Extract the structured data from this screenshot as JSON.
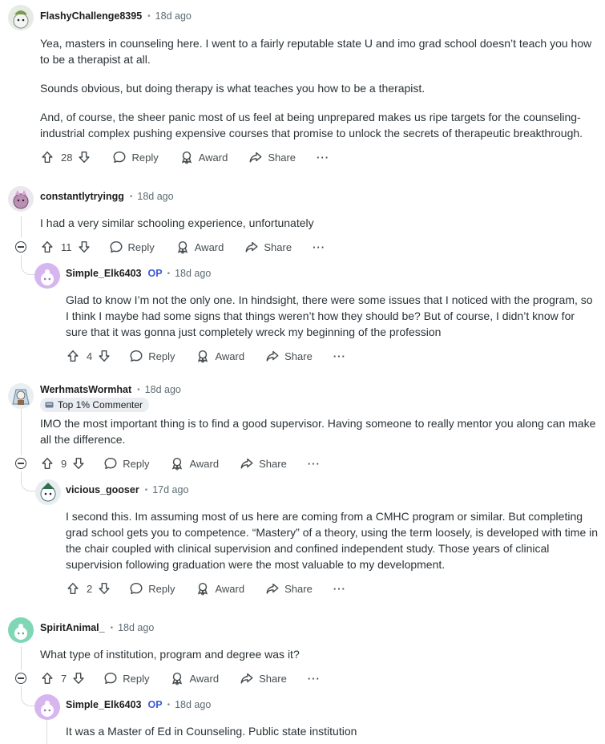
{
  "comments": [
    {
      "author": "FlashyChallenge8395",
      "time": "18d ago",
      "paragraphs": [
        "Yea, masters in counseling here. I went to a fairly reputable state U and imo grad school doesn’t teach you how to be a therapist at all.",
        "Sounds obvious, but doing therapy is what teaches you how to be a therapist.",
        "And, of course, the sheer panic most of us feel at being unprepared makes us ripe targets for the counseling-industrial complex pushing expensive courses that promise to unlock the secrets of therapeutic breakthrough."
      ],
      "votes": "28"
    },
    {
      "author": "constantlytryingg",
      "time": "18d ago",
      "paragraphs": [
        "I had a very similar schooling experience, unfortunately"
      ],
      "votes": "11"
    },
    {
      "author": "Simple_Elk6403",
      "op": "OP",
      "time": "18d ago",
      "paragraphs": [
        "Glad to know I’m not the only one. In hindsight, there were some issues that I noticed with the program, so I think I maybe had some signs that things weren’t how they should be? But of course, I didn’t know for sure that it was gonna just completely wreck my beginning of the profession"
      ],
      "votes": "4"
    },
    {
      "author": "WerhmatsWormhat",
      "time": "18d ago",
      "flair": "Top 1% Commenter",
      "paragraphs": [
        "IMO the most important thing is to find a good supervisor. Having someone to really mentor you along can make all the difference."
      ],
      "votes": "9"
    },
    {
      "author": "vicious_gooser",
      "time": "17d ago",
      "paragraphs": [
        "I second this. Im assuming most of us here are coming from a CMHC program or similar. But completing grad school gets you to competence. “Mastery” of a theory, using the term loosely, is developed with time in the chair coupled with clinical supervision and confined independent study. Those years of clinical supervision following graduation were the most valuable to my development."
      ],
      "votes": "2"
    },
    {
      "author": "SpiritAnimal_",
      "time": "18d ago",
      "paragraphs": [
        "What type of institution, program and degree was it?"
      ],
      "votes": "7"
    },
    {
      "author": "Simple_Elk6403",
      "op": "OP",
      "time": "18d ago",
      "paragraphs": [
        "It was a Master of Ed in Counseling. Public state institution"
      ]
    }
  ],
  "actions": {
    "reply": "Reply",
    "award": "Award",
    "share": "Share",
    "more": "···"
  },
  "colors": {
    "op_blue": "#3a5ad9",
    "thread_line": "#d8dce0",
    "flair_bg": "#eaedf1"
  }
}
